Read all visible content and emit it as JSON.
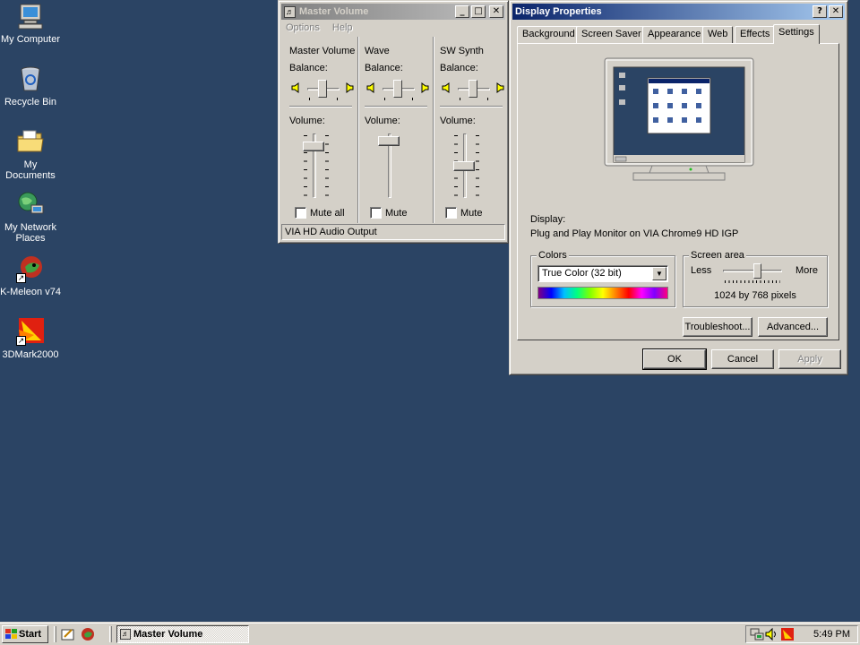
{
  "desktop": {
    "icons": [
      {
        "label": "My Computer",
        "icon": "computer-icon"
      },
      {
        "label": "Recycle Bin",
        "icon": "recycle-bin-icon"
      },
      {
        "label": "My Documents",
        "icon": "folder-icon"
      },
      {
        "label": "My Network Places",
        "icon": "network-icon"
      },
      {
        "label": "K-Meleon v74",
        "icon": "kmeleon-icon"
      },
      {
        "label": "3DMark2000",
        "icon": "3dmark-icon"
      }
    ]
  },
  "master_volume": {
    "title": "Master Volume",
    "menu": [
      "Options",
      "Help"
    ],
    "channels": [
      {
        "name": "Master Volume",
        "balance_label": "Balance:",
        "volume_label": "Volume:",
        "mute_label": "Mute all",
        "muted": false,
        "volume_level": 0.85
      },
      {
        "name": "Wave",
        "balance_label": "Balance:",
        "volume_label": "Volume:",
        "mute_label": "Mute",
        "muted": false,
        "volume_level": 0.95
      },
      {
        "name": "SW Synth",
        "balance_label": "Balance:",
        "volume_label": "Volume:",
        "mute_label": "Mute",
        "muted": false,
        "volume_level": 0.5
      }
    ],
    "status": "VIA HD Audio Output"
  },
  "display_properties": {
    "title": "Display Properties",
    "tabs": [
      "Background",
      "Screen Saver",
      "Appearance",
      "Web",
      "Effects",
      "Settings"
    ],
    "active_tab": "Settings",
    "display_label": "Display:",
    "display_value": "Plug and Play Monitor on VIA Chrome9 HD IGP",
    "colors": {
      "title": "Colors",
      "selected": "True Color (32 bit)"
    },
    "screen_area": {
      "title": "Screen area",
      "less": "Less",
      "more": "More",
      "value": "1024 by 768 pixels",
      "slider_level": 0.6
    },
    "buttons": {
      "troubleshoot": "Troubleshoot...",
      "advanced": "Advanced...",
      "ok": "OK",
      "cancel": "Cancel",
      "apply": "Apply"
    }
  },
  "taskbar": {
    "start_label": "Start",
    "task_button": "Master Volume",
    "clock": "5:49 PM"
  },
  "colors": {
    "desktop_bg": "#2b4464",
    "title_active": "#0a246a",
    "face": "#d4d0c8"
  }
}
